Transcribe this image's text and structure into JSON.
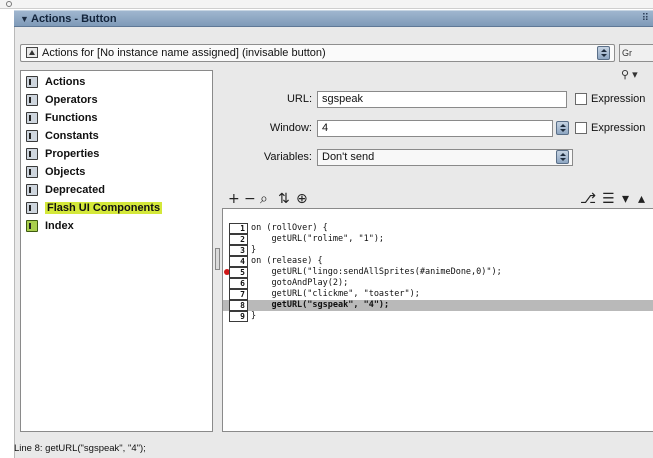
{
  "panel": {
    "title": "Actions - Button",
    "target_label": "Actions for [No instance name assigned]  (invisable button)"
  },
  "toolbox": {
    "items": [
      {
        "label": "Actions",
        "icon": "book-icon",
        "highlighted": false
      },
      {
        "label": "Operators",
        "icon": "book-icon",
        "highlighted": false
      },
      {
        "label": "Functions",
        "icon": "book-icon",
        "highlighted": false
      },
      {
        "label": "Constants",
        "icon": "book-icon",
        "highlighted": false
      },
      {
        "label": "Properties",
        "icon": "book-icon",
        "highlighted": false
      },
      {
        "label": "Objects",
        "icon": "book-icon",
        "highlighted": false
      },
      {
        "label": "Deprecated",
        "icon": "book-icon",
        "highlighted": false
      },
      {
        "label": "Flash UI Components",
        "icon": "book-icon",
        "highlighted": true
      },
      {
        "label": "Index",
        "icon": "green-book-icon",
        "highlighted": false
      }
    ]
  },
  "params": {
    "url_label": "URL:",
    "url_value": "sgspeak",
    "window_label": "Window:",
    "window_value": "4",
    "variables_label": "Variables:",
    "variables_value": "Don't send",
    "expression_label": "Expression"
  },
  "script_tools": {
    "add": "+",
    "remove": "−",
    "find": "⌕",
    "replace": "⇅",
    "target": "⊕",
    "debug": "⎇",
    "view": "☰",
    "menu_down": "▾",
    "menu_up": "▴"
  },
  "code": {
    "lines": [
      {
        "num": "1",
        "text": "on (rollOver) {",
        "current": false,
        "breakpoint": false
      },
      {
        "num": "2",
        "text": "    getURL(\"rolime\", \"1\");",
        "current": false,
        "breakpoint": false
      },
      {
        "num": "3",
        "text": "}",
        "current": false,
        "breakpoint": false
      },
      {
        "num": "4",
        "text": "on (release) {",
        "current": false,
        "breakpoint": false
      },
      {
        "num": "5",
        "text": "    getURL(\"lingo:sendAllSprites(#animeDone,0)\");",
        "current": false,
        "breakpoint": true
      },
      {
        "num": "6",
        "text": "    gotoAndPlay(2);",
        "current": false,
        "breakpoint": false
      },
      {
        "num": "7",
        "text": "    getURL(\"clickme\", \"toaster\");",
        "current": false,
        "breakpoint": false
      },
      {
        "num": "8",
        "text": "    getURL(\"sgspeak\", \"4\");",
        "current": true,
        "breakpoint": false
      },
      {
        "num": "9",
        "text": "}",
        "current": false,
        "breakpoint": false
      }
    ]
  },
  "status": {
    "text": "Line 8: getURL(\"sgspeak\", \"4\");"
  }
}
